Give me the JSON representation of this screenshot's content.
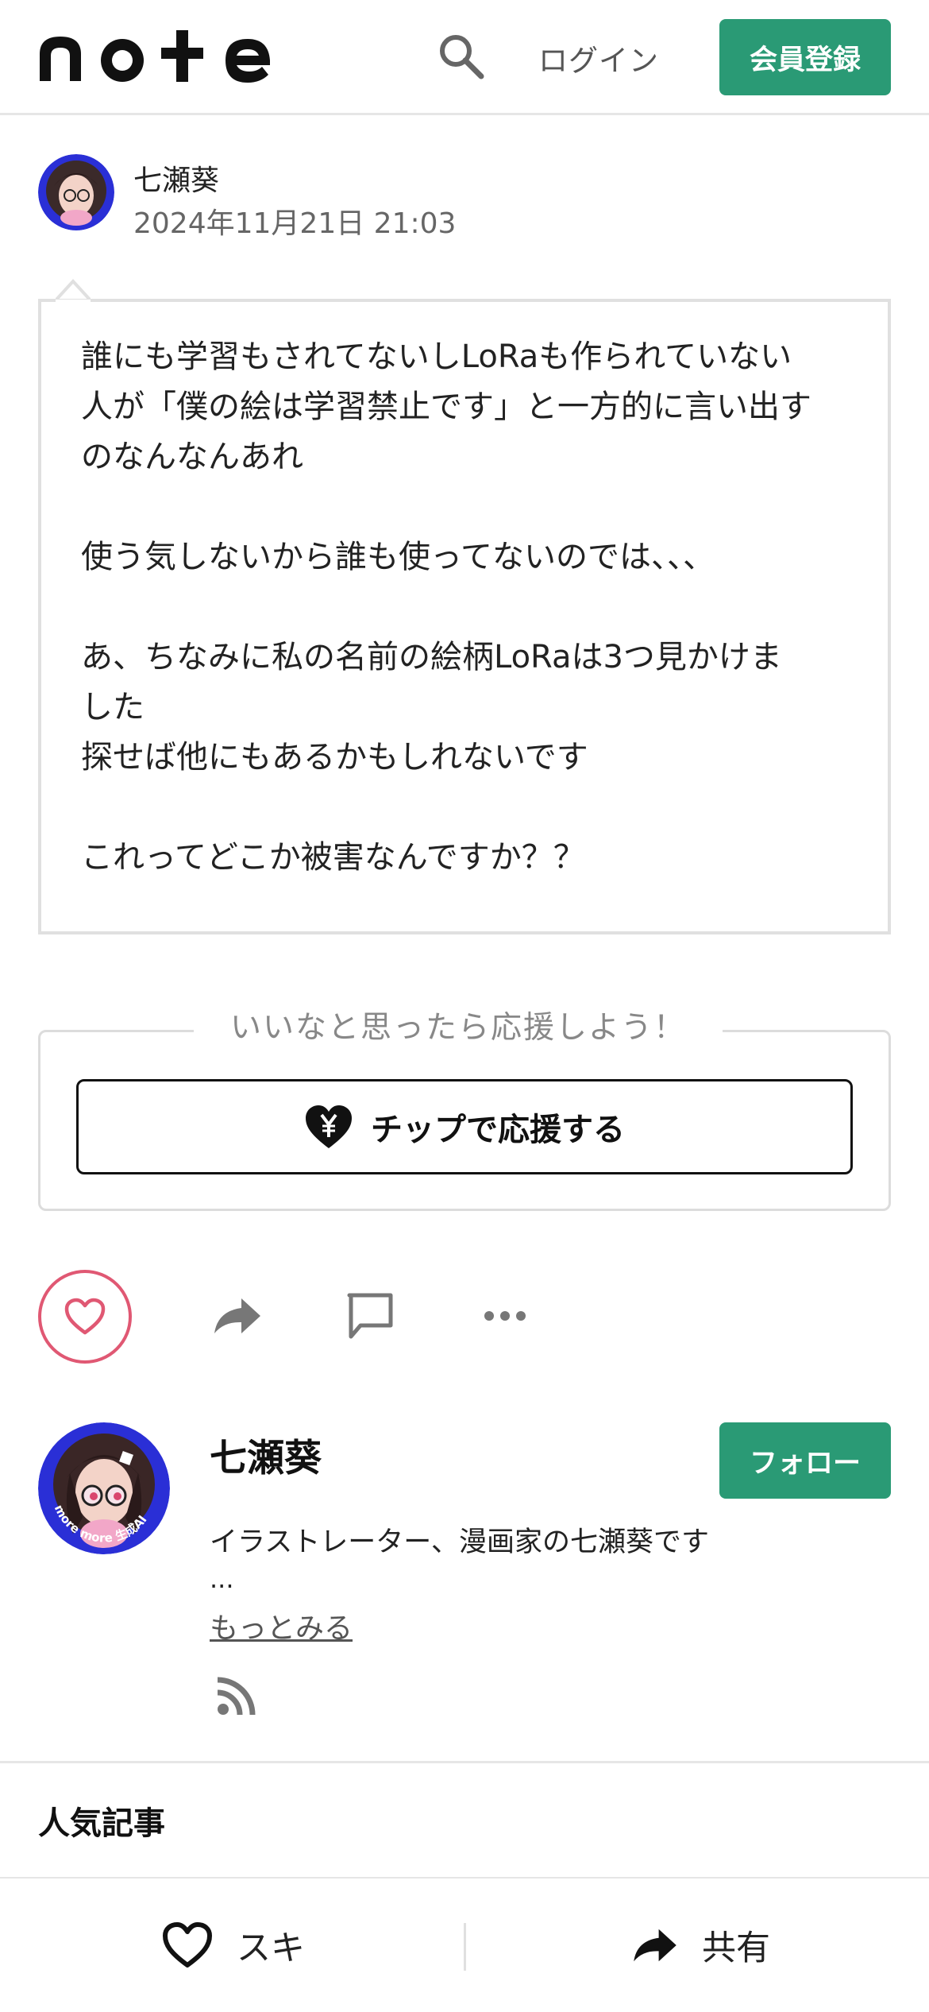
{
  "header": {
    "logo_text": "note",
    "login_label": "ログイン",
    "signup_label": "会員登録",
    "search_icon": "search-icon"
  },
  "post": {
    "author_name": "七瀬葵",
    "date": "2024年11月21日 21:03",
    "body": "誰にも学習もされてないしLoRaも作られていない\n人が「僕の絵は学習禁止です」と一方的に言い出す\nのなんなんあれ\n\n使う気しないから誰も使ってないのでは、、、\n\nあ、ちなみに私の名前の絵柄LoRaは3つ見かけま\nした\n探せば他にもあるかもしれないです\n\nこれってどこか被害なんですか？？"
  },
  "support": {
    "caption": "いいなと思ったら応援しよう！",
    "tip_label": "チップで応援する",
    "tip_icon": "heart-yen-icon"
  },
  "actions": {
    "like_icon": "heart-icon",
    "share_icon": "share-icon",
    "comment_icon": "comment-icon",
    "more_icon": "more-icon"
  },
  "creator": {
    "name": "七瀬葵",
    "follow_label": "フォロー",
    "bio": "イラストレーター、漫画家の七瀬葵です",
    "ellipsis": "...",
    "see_more_label": "もっとみる",
    "avatar_badge_text": "more more 生成AI",
    "rss_icon": "rss-icon"
  },
  "popular": {
    "heading": "人気記事"
  },
  "bottom_bar": {
    "like_label": "スキ",
    "share_label": "共有"
  },
  "colors": {
    "brand_green": "#2a9a75",
    "like_pink": "#e05873",
    "avatar_blue": "#2a2fd6"
  }
}
